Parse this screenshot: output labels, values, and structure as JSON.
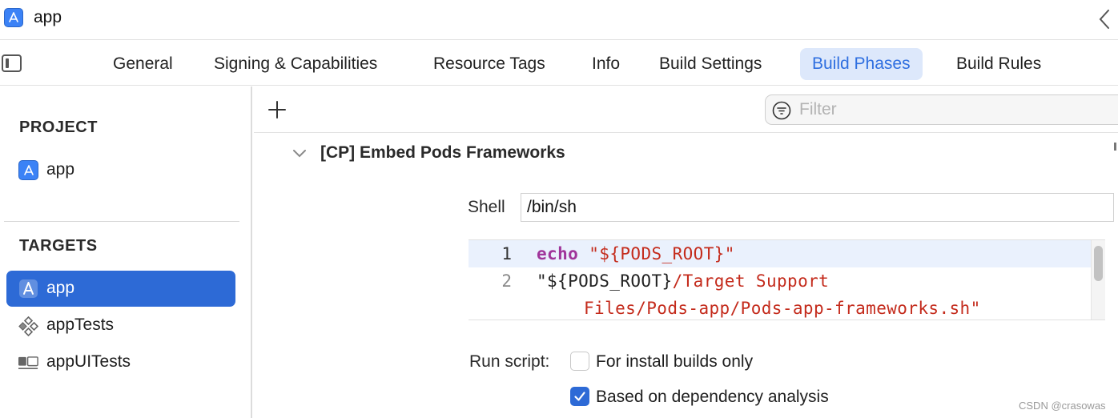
{
  "window": {
    "title": "app"
  },
  "tabs": [
    {
      "label": "General"
    },
    {
      "label": "Signing & Capabilities"
    },
    {
      "label": "Resource Tags"
    },
    {
      "label": "Info"
    },
    {
      "label": "Build Settings"
    },
    {
      "label": "Build Phases",
      "active": true
    },
    {
      "label": "Build Rules"
    }
  ],
  "sidebar": {
    "project_header": "PROJECT",
    "project_item": "app",
    "targets_header": "TARGETS",
    "targets": [
      {
        "label": "app",
        "selected": true,
        "icon": "app-target-icon"
      },
      {
        "label": "appTests",
        "icon": "unit-tests-icon"
      },
      {
        "label": "appUITests",
        "icon": "ui-tests-icon"
      }
    ]
  },
  "toolbar": {
    "filter_placeholder": "Filter"
  },
  "phase": {
    "title": "[CP] Embed Pods Frameworks",
    "shell_label": "Shell",
    "shell_value": "/bin/sh",
    "script_lines": [
      {
        "number": "1",
        "keyword": "echo",
        "text": " \"${PODS_ROOT}\""
      },
      {
        "number": "2",
        "text_plain": "\"${PODS_ROOT}",
        "text_str": "/Target Support",
        "continuation": "Files/Pods-app/Pods-app-frameworks.sh\""
      }
    ],
    "run_script_label": "Run script:",
    "options": [
      {
        "label": "For install builds only",
        "checked": false
      },
      {
        "label": "Based on dependency analysis",
        "checked": true
      }
    ]
  },
  "colors": {
    "accent": "#2d6ad6",
    "keyword": "#a0359a",
    "string": "#c42b1c"
  },
  "watermark": "CSDN @crasowas"
}
